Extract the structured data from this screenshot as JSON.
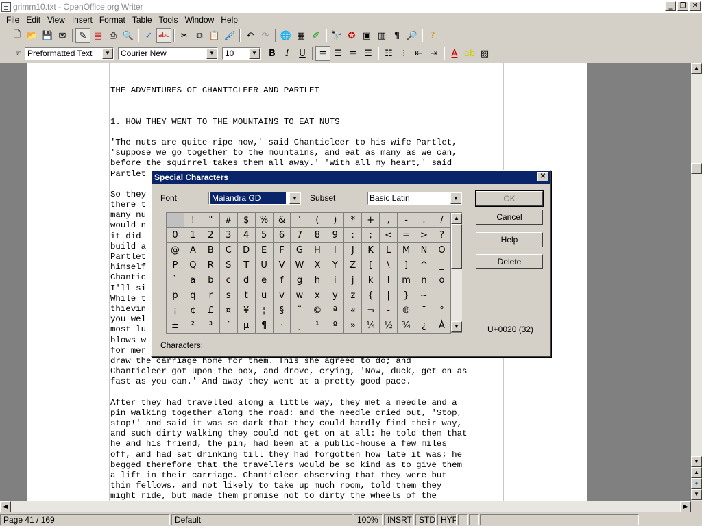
{
  "window": {
    "title": "grimm10.txt - OpenOffice.org Writer",
    "min": "_",
    "max": "❐",
    "close": "✕"
  },
  "menu": [
    "File",
    "Edit",
    "View",
    "Insert",
    "Format",
    "Table",
    "Tools",
    "Window",
    "Help"
  ],
  "toolbar1": [
    "new-icon",
    "open-icon",
    "save-icon",
    "email-icon",
    "edit-mode-icon",
    "pdf-icon",
    "print-icon",
    "preview-icon",
    "spellcheck-icon",
    "autospell-icon",
    "cut-icon",
    "copy-icon",
    "paste-icon",
    "format-paintbrush-icon",
    "undo-icon",
    "redo-icon",
    "hyperlink-icon",
    "table-icon",
    "draw-icon",
    "find-icon",
    "navigator-icon",
    "gallery-icon",
    "datasource-icon",
    "nonprinting-chars-icon",
    "zoom-icon",
    "help-icon"
  ],
  "format": {
    "style": "Preformatted Text",
    "font": "Courier New",
    "size": "10",
    "bold": "B",
    "italic": "I",
    "underline": "U"
  },
  "document": {
    "lines": [
      "THE ADVENTURES OF CHANTICLEER AND PARTLET",
      "",
      "",
      "1. HOW THEY WENT TO THE MOUNTAINS TO EAT NUTS",
      "",
      "'The nuts are quite ripe now,' said Chanticleer to his wife Partlet,",
      "'suppose we go together to the mountains, and eat as many as we can,",
      "before the squirrel takes them all away.' 'With all my heart,' said",
      "Partlet",
      "",
      "So they",
      "there t",
      "many nu",
      "would n",
      "it did ",
      "build a",
      "Partlet",
      "himself",
      "Chantic",
      "I'll si",
      "While t",
      "thievin",
      "you wel",
      "most lu",
      "blows w",
      "for mer",
      "draw the carriage home for them. This she agreed to do; and",
      "Chanticleer got upon the box, and drove, crying, 'Now, duck, get on as",
      "fast as you can.' And away they went at a pretty good pace.",
      "",
      "After they had travelled along a little way, they met a needle and a",
      "pin walking together along the road: and the needle cried out, 'Stop,",
      "stop!' and said it was so dark that they could hardly find their way,",
      "and such dirty walking they could not get on at all: he told them that",
      "he and his friend, the pin, had been at a public-house a few miles",
      "off, and had sat drinking till they had forgotten how late it was; he",
      "begged therefore that the travellers would be so kind as to give them",
      "a lift in their carriage. Chanticleer observing that they were but",
      "thin fellows, and not likely to take up much room, told them they",
      "might ride, but made them promise not to dirty the wheels of the"
    ]
  },
  "dialog": {
    "title": "Special Characters",
    "close": "✕",
    "font_label": "Font",
    "font_value": "Maiandra GD",
    "subset_label": "Subset",
    "subset_value": "Basic Latin",
    "characters_label": "Characters:",
    "unicode_readout": "U+0020 (32)",
    "buttons": {
      "ok": "OK",
      "cancel": "Cancel",
      "help": "Help",
      "delete": "Delete"
    },
    "grid": [
      [
        " ",
        "!",
        "\"",
        "#",
        "$",
        "%",
        "&",
        "'",
        "(",
        ")",
        "*",
        "+",
        ",",
        "-",
        ".",
        "/"
      ],
      [
        "0",
        "1",
        "2",
        "3",
        "4",
        "5",
        "6",
        "7",
        "8",
        "9",
        ":",
        ";",
        "<",
        "=",
        ">",
        "?"
      ],
      [
        "@",
        "A",
        "B",
        "C",
        "D",
        "E",
        "F",
        "G",
        "H",
        "I",
        "J",
        "K",
        "L",
        "M",
        "N",
        "O"
      ],
      [
        "P",
        "Q",
        "R",
        "S",
        "T",
        "U",
        "V",
        "W",
        "X",
        "Y",
        "Z",
        "[",
        "\\",
        "]",
        "^",
        "_"
      ],
      [
        "`",
        "a",
        "b",
        "c",
        "d",
        "e",
        "f",
        "g",
        "h",
        "i",
        "j",
        "k",
        "l",
        "m",
        "n",
        "o"
      ],
      [
        "p",
        "q",
        "r",
        "s",
        "t",
        "u",
        "v",
        "w",
        "x",
        "y",
        "z",
        "{",
        "|",
        "}",
        "~",
        ""
      ],
      [
        "¡",
        "¢",
        "£",
        "¤",
        "¥",
        "¦",
        "§",
        "¨",
        "©",
        "ª",
        "«",
        "¬",
        "-",
        "®",
        "¯",
        "°"
      ],
      [
        "±",
        "²",
        "³",
        "´",
        "µ",
        "¶",
        "·",
        "¸",
        "¹",
        "º",
        "»",
        "¼",
        "½",
        "¾",
        "¿",
        "À"
      ]
    ]
  },
  "status": {
    "page": "Page 41 / 169",
    "style": "Default",
    "zoom": "100%",
    "insert": "INSRT",
    "selection": "STD",
    "hyperlink": "HYP"
  }
}
